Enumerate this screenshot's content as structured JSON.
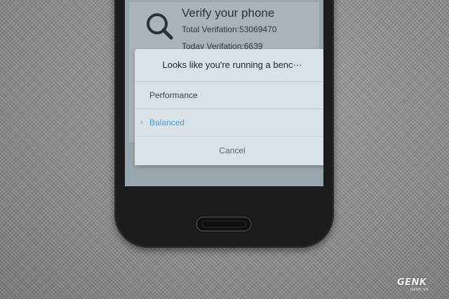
{
  "app": {
    "title": "Verify your phone",
    "total_verification": "Total Verifation:53069470",
    "today_verification": "Today Verifation:6639"
  },
  "dialog": {
    "title": "Looks like you're running a benc···",
    "options": [
      {
        "label": "Performance",
        "selected": false
      },
      {
        "label": "Balanced",
        "selected": true
      }
    ],
    "check_glyph": "›",
    "cancel_label": "Cancel"
  },
  "watermark": {
    "brand": "GENK",
    "tagline": "GENK.VN"
  },
  "colors": {
    "selected_option": "#4a9ee0",
    "dialog_background": "#d8e2e7",
    "screen_dim": "#9aa6ad"
  },
  "icons": [
    "search-icon",
    "check-mark-icon"
  ]
}
